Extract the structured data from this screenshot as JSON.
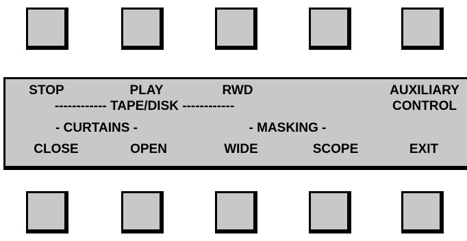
{
  "top_buttons": [
    "",
    "",
    "",
    "",
    ""
  ],
  "bottom_buttons": [
    "",
    "",
    "",
    "",
    ""
  ],
  "display": {
    "row1": {
      "stop": "STOP",
      "play": "PLAY",
      "rwd": "RWD",
      "auxiliary": "AUXILIARY"
    },
    "row2": {
      "tape_disk": "------------ TAPE/DISK ------------",
      "control": "CONTROL"
    },
    "row3": {
      "curtains": "- CURTAINS -",
      "masking": "- MASKING -"
    },
    "row4": {
      "close": "CLOSE",
      "open": "OPEN",
      "wide": "WIDE",
      "scope": "SCOPE",
      "exit": "EXIT"
    }
  },
  "colors": {
    "key_face": "#c8c8c8",
    "panel_bg": "#c8c8c8",
    "border": "#000000",
    "text": "#000000"
  }
}
